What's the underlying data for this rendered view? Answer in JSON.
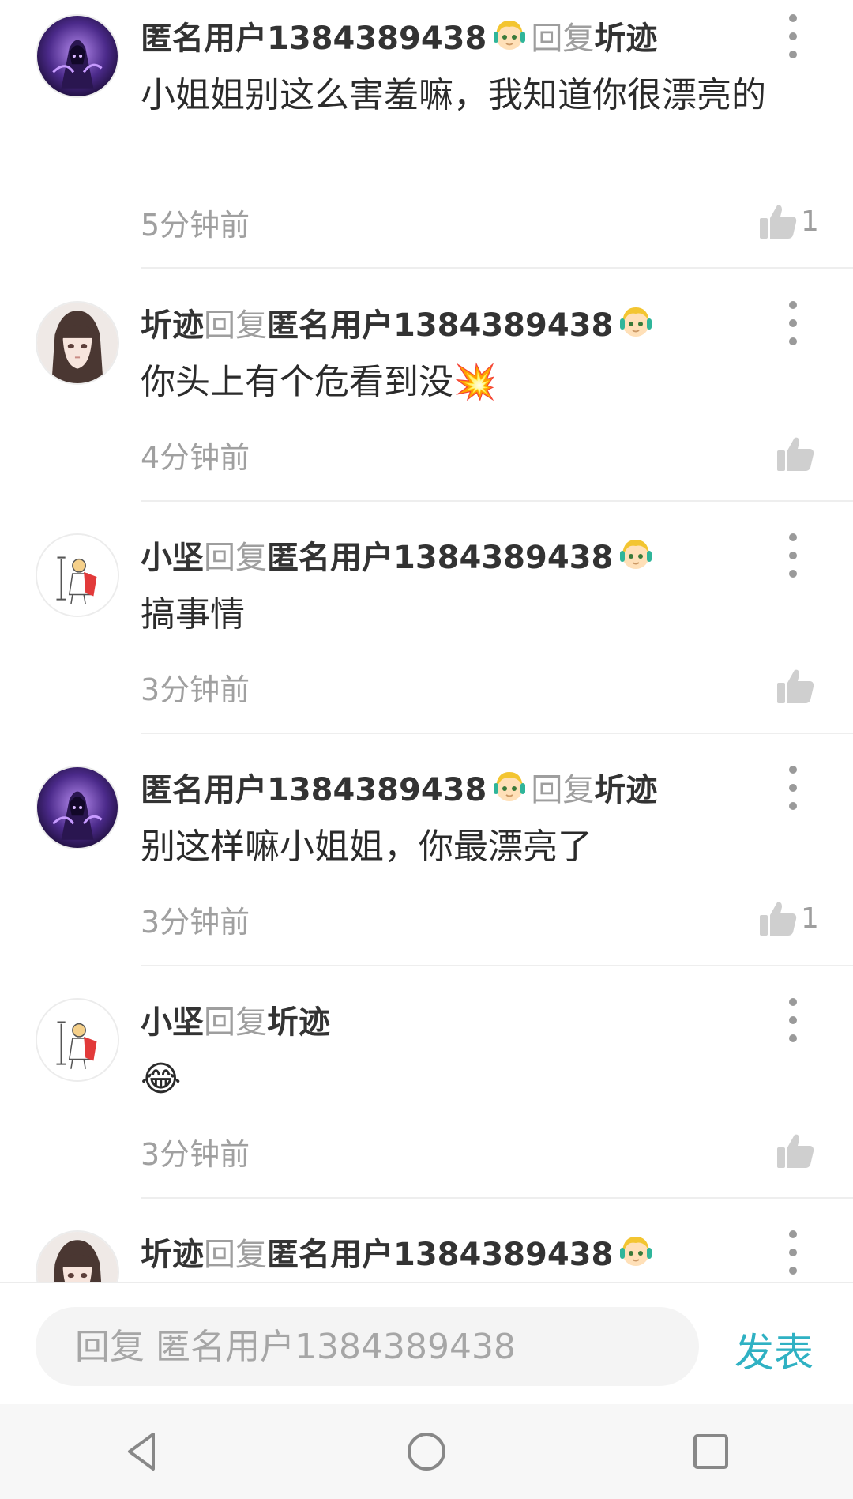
{
  "comments": [
    {
      "author": "匿名用户1384389438",
      "reply_word": "回复",
      "target": "圻迹",
      "text": "小姐姐别这么害羞嘛，我知道你很漂亮的",
      "time": "5分钟前",
      "likes": "1",
      "avatar": "hooded-figure-avatar"
    },
    {
      "author": "圻迹",
      "reply_word": "回复",
      "target": "匿名用户1384389438",
      "text": "你头上有个危看到没💥",
      "time": "4分钟前",
      "likes": "",
      "avatar": "anime-girl-avatar"
    },
    {
      "author": "小坚",
      "reply_word": "回复",
      "target": "匿名用户1384389438",
      "text": "搞事情",
      "time": "3分钟前",
      "likes": "",
      "avatar": "hero-sketch-avatar"
    },
    {
      "author": "匿名用户1384389438",
      "reply_word": "回复",
      "target": "圻迹",
      "text": "别这样嘛小姐姐，你最漂亮了",
      "time": "3分钟前",
      "likes": "1",
      "avatar": "hooded-figure-avatar"
    },
    {
      "author": "小坚",
      "reply_word": "回复",
      "target": "圻迹",
      "text": "😂",
      "time": "3分钟前",
      "likes": "",
      "avatar": "hero-sketch-avatar"
    },
    {
      "author": "圻迹",
      "reply_word": "回复",
      "target": "匿名用户1384389438",
      "text": "",
      "time": "",
      "likes": "",
      "avatar": "anime-girl-avatar"
    }
  ],
  "reply_input": {
    "placeholder": "回复 匿名用户1384389438"
  },
  "send_label": "发表",
  "colors": {
    "accent": "#2fb1c3",
    "muted_text": "#a0a0a0",
    "name_text": "#333333"
  },
  "icons": {
    "badge": "anonymous-user-badge-icon",
    "like": "thumbs-up-icon",
    "more": "more-vertical-icon",
    "nav_back": "back-triangle-icon",
    "nav_home": "home-circle-icon",
    "nav_recent": "recent-square-icon"
  }
}
